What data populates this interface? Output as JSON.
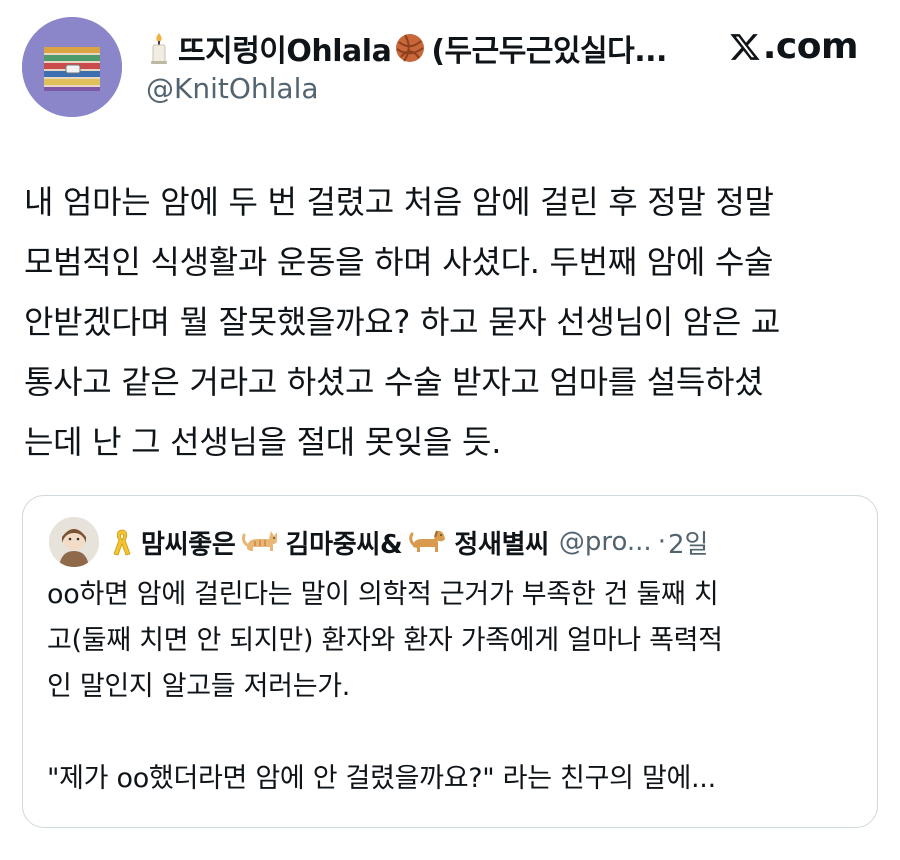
{
  "author": {
    "display_name": "뜨지렁이Ohlala",
    "name_suffix": "(두근두근있실다...",
    "handle": "@KnitOhlala",
    "emoji_before": "candle-icon",
    "emoji_after": "yarn-ball-icon"
  },
  "site": {
    "label": ".com",
    "logo_icon": "x-logo-icon"
  },
  "tweet": {
    "lines": [
      "내 엄마는 암에 두 번 걸렸고 처음 암에 걸린 후 정말 정말",
      "모범적인 식생활과 운동을 하며 사셨다. 두번째 암에 수술",
      "안받겠다며 뭘 잘못했을까요? 하고 묻자 선생님이 암은 교",
      "통사고 같은 거라고 하셨고 수술 받자고 엄마를 설득하셨",
      "는데 난 그 선생님을 절대 못잊을 듯."
    ]
  },
  "quote": {
    "name_part1": "맘씨좋은",
    "name_part2": "김마중씨&",
    "name_part3": "정새별씨",
    "handle": "@pro...",
    "separator": "·",
    "time": "2일",
    "ribbon_icon": "yellow-ribbon-icon",
    "cat_icon": "cat-icon",
    "dog_icon": "dog-icon",
    "lines": [
      "oo하면 암에 걸린다는 말이 의학적 근거가 부족한 건 둘째 치",
      "고(둘째 치면 안 되지만) 환자와 환자 가족에게 얼마나 폭력적",
      "인 말인지 알고들 저러는가.",
      "",
      "\"제가 oo했더라면 암에 안 걸렸을까요?\" 라는 친구의 말에..."
    ]
  },
  "colors": {
    "text": "#0f1419",
    "secondary": "#536471",
    "border": "#cfd9de",
    "avatar_bg": "#8a86c9"
  }
}
